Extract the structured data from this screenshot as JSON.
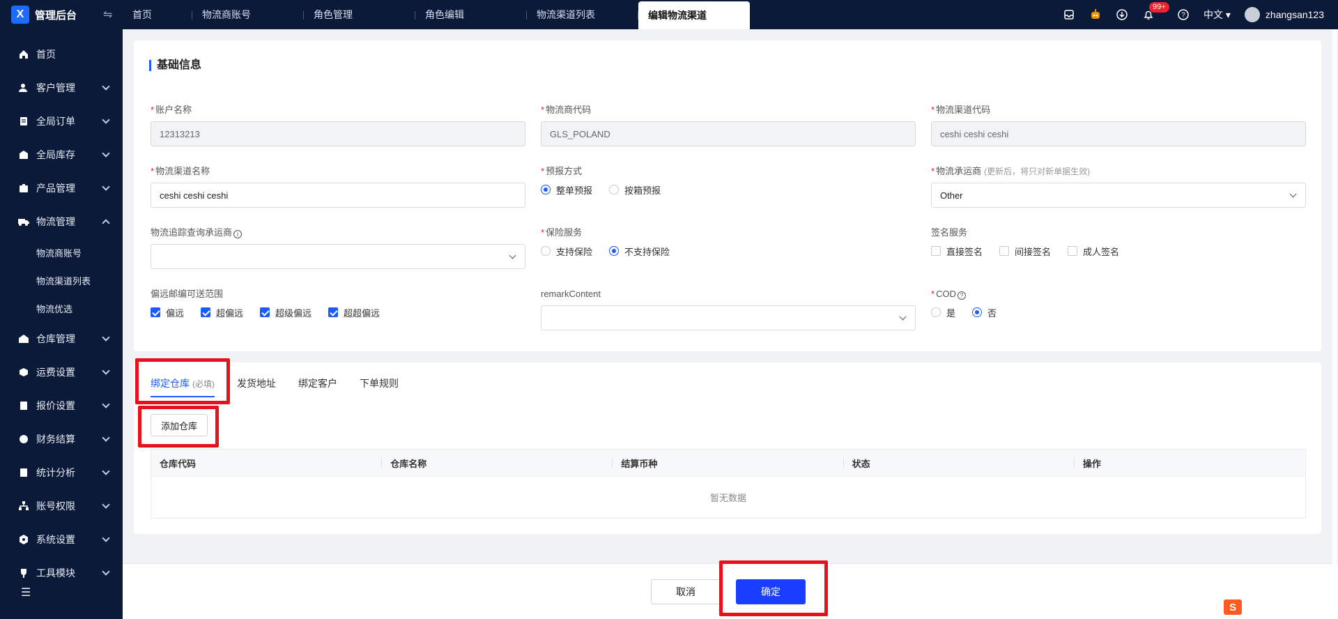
{
  "app": {
    "brand": "管理后台",
    "logo_letter": "X"
  },
  "tabs": [
    {
      "label": "首页"
    },
    {
      "label": "物流商账号"
    },
    {
      "label": "角色管理"
    },
    {
      "label": "角色编辑"
    },
    {
      "label": "物流渠道列表"
    },
    {
      "label": "编辑物流渠道"
    }
  ],
  "header": {
    "badge": "99+",
    "language": "中文",
    "user": "zhangsan123"
  },
  "sidebar": {
    "items": [
      {
        "label": "首页",
        "icon": "home-icon"
      },
      {
        "label": "客户管理",
        "icon": "customers-icon"
      },
      {
        "label": "全局订单",
        "icon": "order-icon"
      },
      {
        "label": "全局库存",
        "icon": "inventory-icon"
      },
      {
        "label": "产品管理",
        "icon": "product-icon"
      },
      {
        "label": "物流管理",
        "icon": "truck-icon"
      },
      {
        "label": "仓库管理",
        "icon": "warehouse-icon"
      },
      {
        "label": "运费设置",
        "icon": "freight-icon"
      },
      {
        "label": "报价设置",
        "icon": "quote-icon"
      },
      {
        "label": "财务结算",
        "icon": "finance-icon"
      },
      {
        "label": "统计分析",
        "icon": "stats-icon"
      },
      {
        "label": "账号权限",
        "icon": "org-icon"
      },
      {
        "label": "系统设置",
        "icon": "settings-icon"
      },
      {
        "label": "工具模块",
        "icon": "tool-icon"
      }
    ],
    "sub_items": [
      "物流商账号",
      "物流渠道列表",
      "物流优选"
    ]
  },
  "basic": {
    "title": "基础信息",
    "account_name": {
      "label": "账户名称",
      "value": "12313213"
    },
    "carrier_code": {
      "label": "物流商代码",
      "value": "GLS_POLAND"
    },
    "channel_code": {
      "label": "物流渠道代码",
      "value": "ceshi ceshi ceshi"
    },
    "channel_name": {
      "label": "物流渠道名称",
      "value": "ceshi ceshi ceshi"
    },
    "forecast": {
      "label": "预报方式",
      "options": [
        "整单预报",
        "按箱预报"
      ],
      "selected": 0
    },
    "shipper": {
      "label": "物流承运商",
      "hint": "(更新后，将只对新单据生效)",
      "value": "Other"
    },
    "tracking_carrier": {
      "label": "物流追踪查询承运商",
      "value": ""
    },
    "insurance": {
      "label": "保险服务",
      "options": [
        "支持保险",
        "不支持保险"
      ],
      "selected": 1
    },
    "signature": {
      "label": "签名服务",
      "options": [
        "直接签名",
        "间接签名",
        "成人签名"
      ]
    },
    "remote": {
      "label": "偏远邮编可送范围",
      "options": [
        "偏远",
        "超偏远",
        "超级偏远",
        "超超偏远"
      ]
    },
    "remark": {
      "label": "remarkContent",
      "value": ""
    },
    "cod": {
      "label": "COD",
      "options": [
        "是",
        "否"
      ],
      "selected": 1
    }
  },
  "warehouse_tabs": {
    "tabs": [
      "绑定仓库",
      "发货地址",
      "绑定客户",
      "下单规则"
    ],
    "required_hint": "(必填)",
    "add_button": "添加仓库",
    "columns": [
      "仓库代码",
      "仓库名称",
      "结算币种",
      "状态",
      "操作"
    ],
    "empty_text": "暂无数据"
  },
  "footer": {
    "cancel": "取消",
    "confirm": "确定"
  }
}
